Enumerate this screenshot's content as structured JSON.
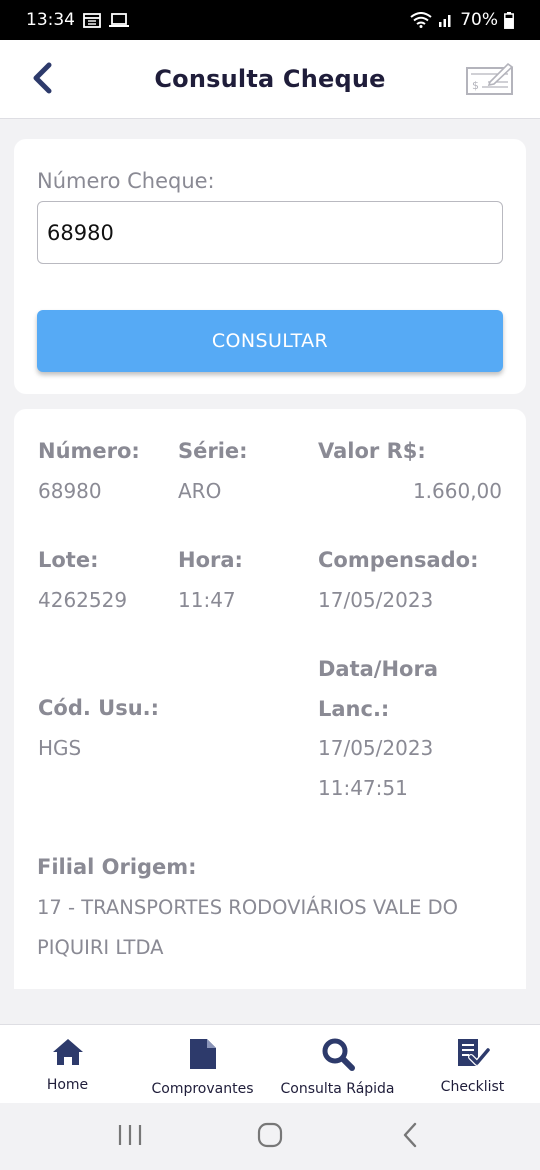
{
  "status_bar": {
    "time": "13:34",
    "battery": "70%",
    "icons": [
      "calendar-icon",
      "laptop-icon",
      "wifi-icon",
      "signal-icon",
      "battery-icon"
    ]
  },
  "header": {
    "title": "Consulta Cheque",
    "back_icon": "chevron-left-icon",
    "right_icon": "check-bank-icon"
  },
  "search": {
    "label": "Número Cheque:",
    "value": "68980",
    "button_label": "CONSULTAR"
  },
  "result": {
    "numero_label": "Número:",
    "numero_value": "68980",
    "serie_label": "Série:",
    "serie_value": "ARO",
    "valor_label": "Valor R$:",
    "valor_value": "1.660,00",
    "lote_label": "Lote:",
    "lote_value": "4262529",
    "hora_label": "Hora:",
    "hora_value": "11:47",
    "compensado_label": "Compensado:",
    "compensado_value": "17/05/2023",
    "cod_usu_label": "Cód. Usu.:",
    "cod_usu_value": "HGS",
    "data_hora_label_line1": "Data/Hora",
    "data_hora_label_line2": "Lanc.:",
    "data_hora_value_line1": "17/05/2023",
    "data_hora_value_line2": "11:47:51",
    "filial_label": "Filial Origem:",
    "filial_value_line1": "17 - TRANSPORTES RODOVIÁRIOS VALE DO",
    "filial_value_line2": "PIQUIRI LTDA"
  },
  "bottom_nav": {
    "items": [
      {
        "label": "Home",
        "icon": "home-icon"
      },
      {
        "label": "Comprovantes",
        "icon": "document-icon"
      },
      {
        "label": "Consulta Rápida",
        "icon": "search-icon"
      },
      {
        "label": "Checklist",
        "icon": "checklist-icon"
      }
    ]
  },
  "colors": {
    "accent": "#56aaf5",
    "navy": "#2d3a6b",
    "muted_text": "#8a8a94",
    "title_text": "#1f1d3a"
  }
}
